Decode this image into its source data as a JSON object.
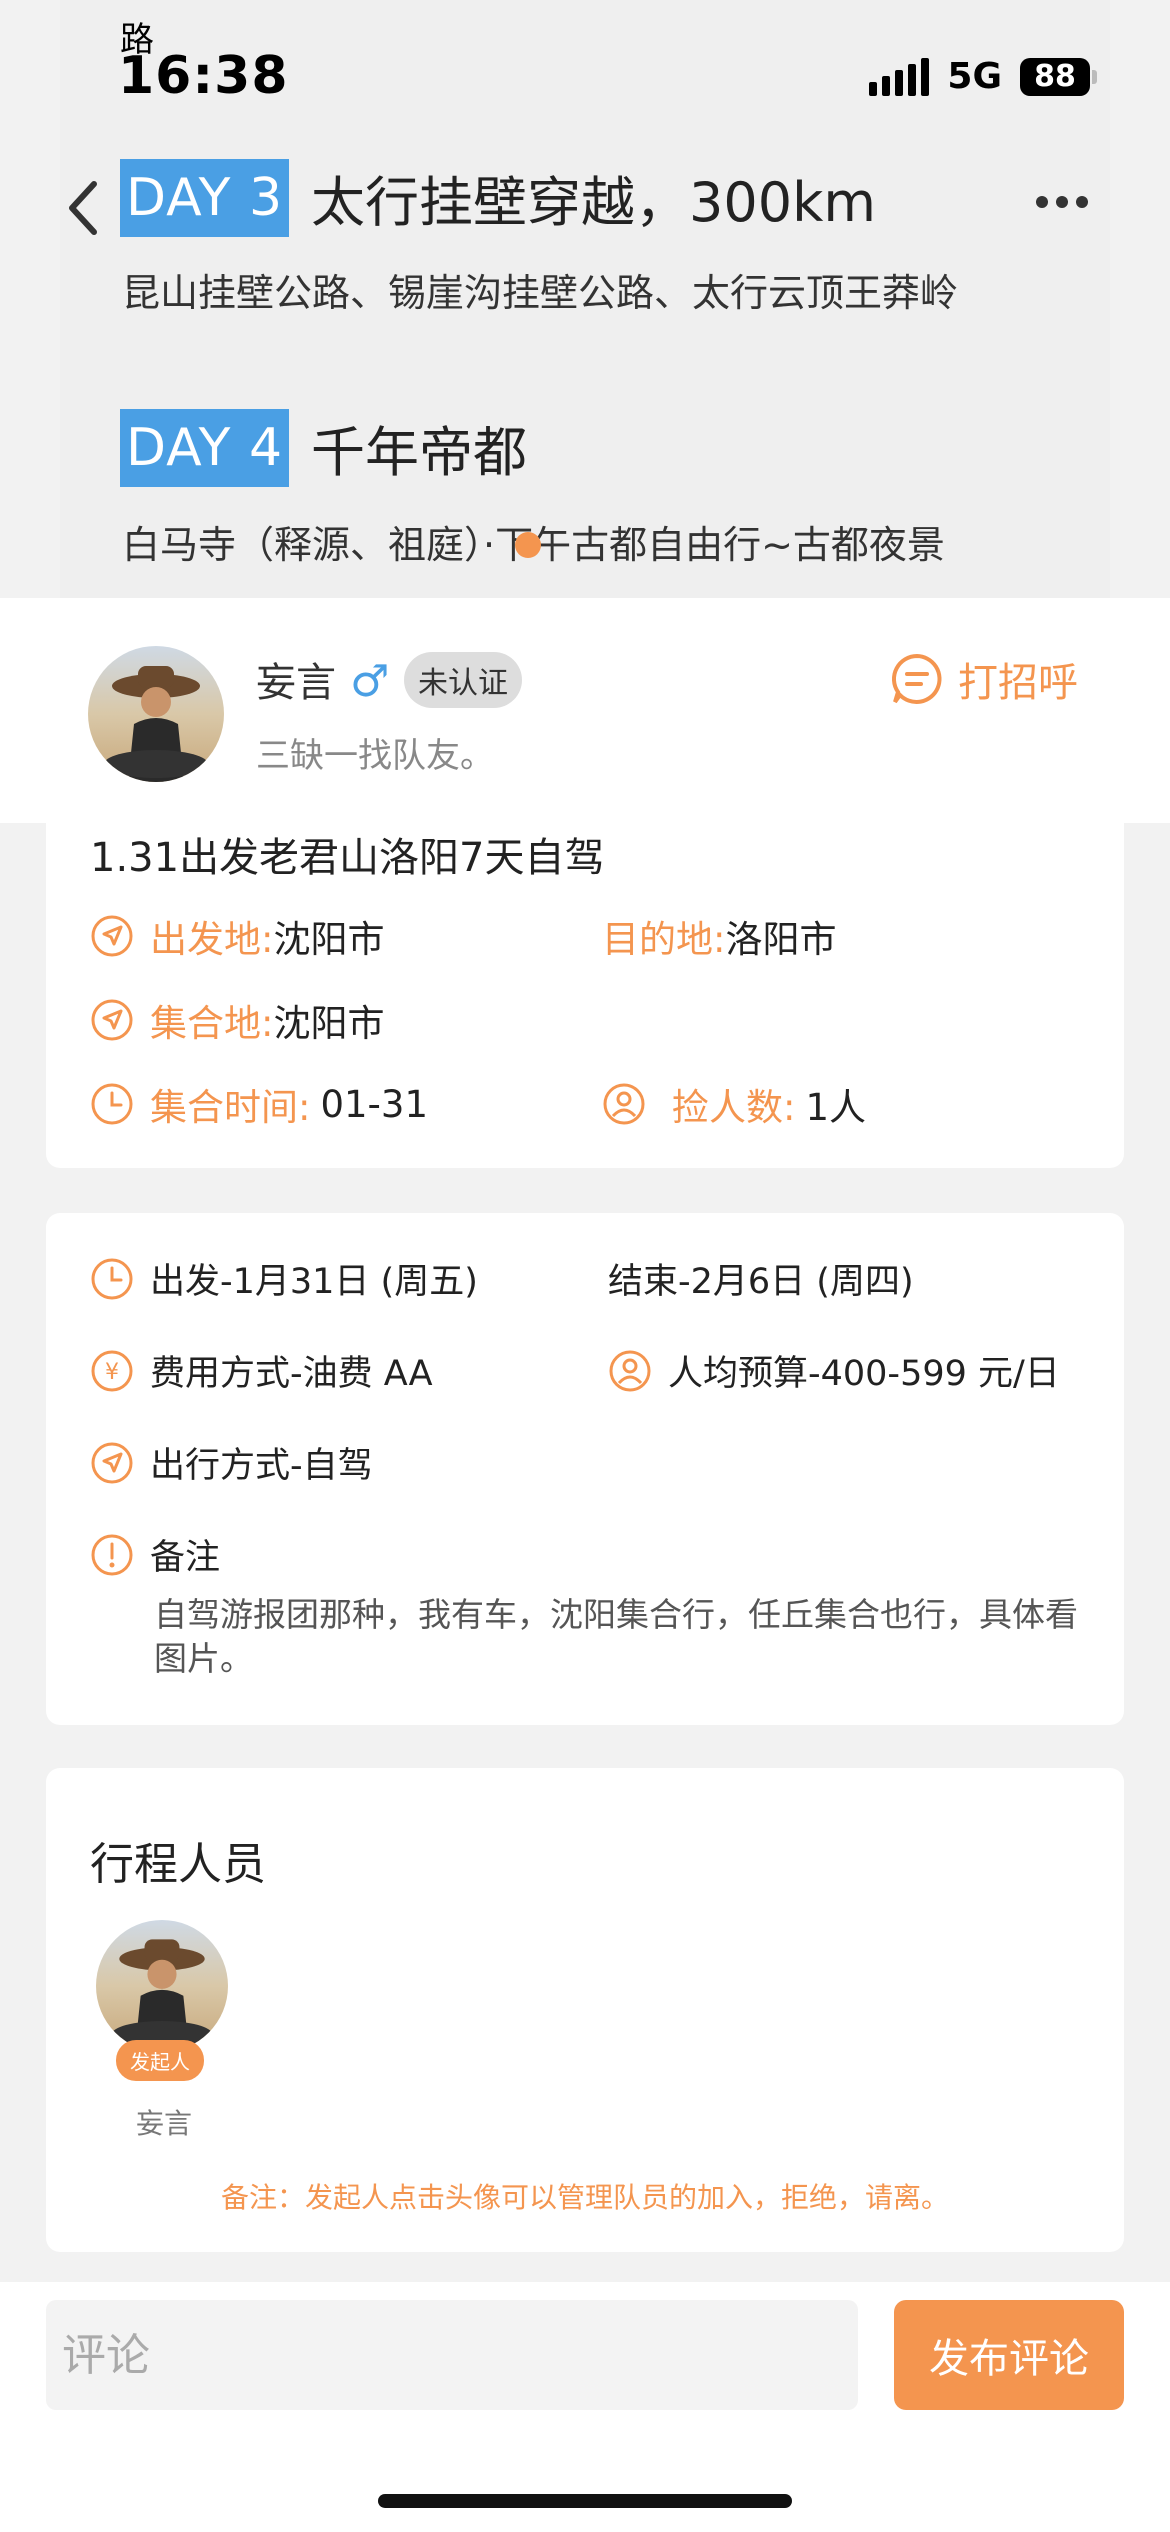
{
  "status_bar": {
    "app_label": "路",
    "time": "16:38",
    "network": "5G",
    "battery": "88"
  },
  "itinerary": [
    {
      "day": "DAY 3",
      "title": "太行挂壁穿越，300km",
      "desc": "昆山挂壁公路、锡崖沟挂壁公路、太行云顶王莽岭"
    },
    {
      "day": "DAY 4",
      "title": "千年帝都",
      "desc": "白马寺（释源、祖庭）·下午古都自由行~古都夜景"
    }
  ],
  "profile": {
    "name": "妄言",
    "gender_symbol": "♂",
    "badge": "未认证",
    "bio": "三缺一找队友。",
    "greet_label": "打招呼"
  },
  "trip": {
    "title": "1.31出发老君山洛阳7天自驾",
    "departure_label": "出发地:",
    "departure_value": "沈阳市",
    "destination_label": "目的地:",
    "destination_value": "洛阳市",
    "meet_label": "集合地:",
    "meet_value": "沈阳市",
    "meet_time_label": "集合时间:",
    "meet_time_value": "01-31",
    "pickup_label": "捡人数:",
    "pickup_value": "1人"
  },
  "details": {
    "start": "出发-1月31日 (周五)",
    "end": "结束-2月6日 (周四)",
    "cost": "费用方式-油费 AA",
    "budget": "人均预算-400-599 元/日",
    "travel_mode": "出行方式-自驾",
    "note_label": "备注",
    "note_text": "自驾游报团那种，我有车，沈阳集合行，任丘集合也行，具体看图片。"
  },
  "members": {
    "title": "行程人员",
    "list": [
      {
        "name": "妄言",
        "role": "发起人"
      }
    ],
    "remark": "备注：发起人点击头像可以管理队员的加入，拒绝，请离。"
  },
  "bottom": {
    "comment_placeholder": "评论",
    "publish_label": "发布评论"
  },
  "colors": {
    "accent": "#f4954f",
    "day_badge": "#4a9fe4",
    "male": "#4a9fe4"
  }
}
